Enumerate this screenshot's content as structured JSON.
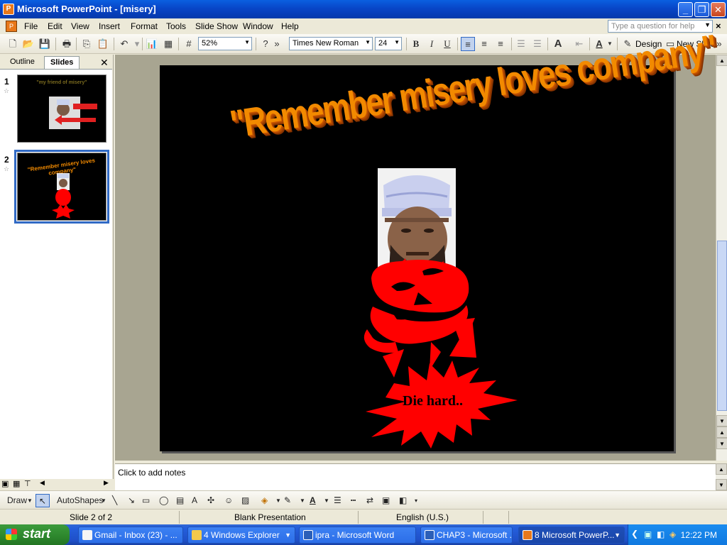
{
  "window": {
    "title": "Microsoft PowerPoint - [misery]"
  },
  "menu": {
    "items": [
      "File",
      "Edit",
      "View",
      "Insert",
      "Format",
      "Tools",
      "Slide Show",
      "Window",
      "Help"
    ],
    "help_placeholder": "Type a question for help"
  },
  "toolbar": {
    "zoom": "52%",
    "font_name": "Times New Roman",
    "font_size": "24",
    "design_label": "Design",
    "new_slide_label": "New Slide"
  },
  "left_pane": {
    "tabs": [
      "Outline",
      "Slides"
    ],
    "active_tab": "Slides",
    "slides": [
      {
        "number": "1",
        "title": "\"my friend of misery\""
      },
      {
        "number": "2",
        "title": "\"Remember misery loves company\""
      }
    ]
  },
  "slide": {
    "wordart": "\"Remember misery loves company\"",
    "burst_text": "Die hard.."
  },
  "notes": {
    "placeholder": "Click to add notes"
  },
  "draw_toolbar": {
    "draw_label": "Draw",
    "autoshapes_label": "AutoShapes"
  },
  "status_bar": {
    "slide_position": "Slide 2 of 2",
    "template": "Blank Presentation",
    "language": "English (U.S.)"
  },
  "taskbar": {
    "start_label": "start",
    "buttons": [
      {
        "label": "Gmail - Inbox (23) - ...",
        "icon": "gmail-icon"
      },
      {
        "label": "4 Windows Explorer",
        "icon": "folder-icon"
      },
      {
        "label": "ipra - Microsoft Word",
        "icon": "word-icon"
      },
      {
        "label": "CHAP3 - Microsoft ...",
        "icon": "word-icon"
      },
      {
        "label": "8 Microsoft PowerP...",
        "icon": "powerpoint-icon"
      }
    ],
    "clock": "12:22 PM"
  },
  "colors": {
    "wordart_orange": "#f28a00",
    "burst_red": "#ff0000",
    "selection_blue": "#316ac5"
  }
}
